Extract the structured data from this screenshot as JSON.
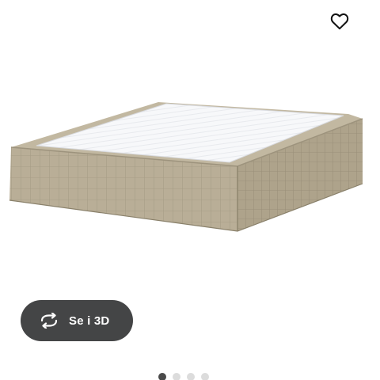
{
  "actions": {
    "view_3d_label": "Se i 3D",
    "favorite_icon": "heart-outline-icon",
    "view_3d_icon": "rotate-arrows-icon"
  },
  "product_image": {
    "icon": "mattress-base-image",
    "fabric_color": "#b7ad96",
    "top_color": "#f6f7f9"
  },
  "carousel": {
    "total": 4,
    "active_index": 0
  },
  "colors": {
    "button_bg": "#444546",
    "dot_active": "#4a4a4a",
    "dot_inactive": "#dcdcdc"
  }
}
